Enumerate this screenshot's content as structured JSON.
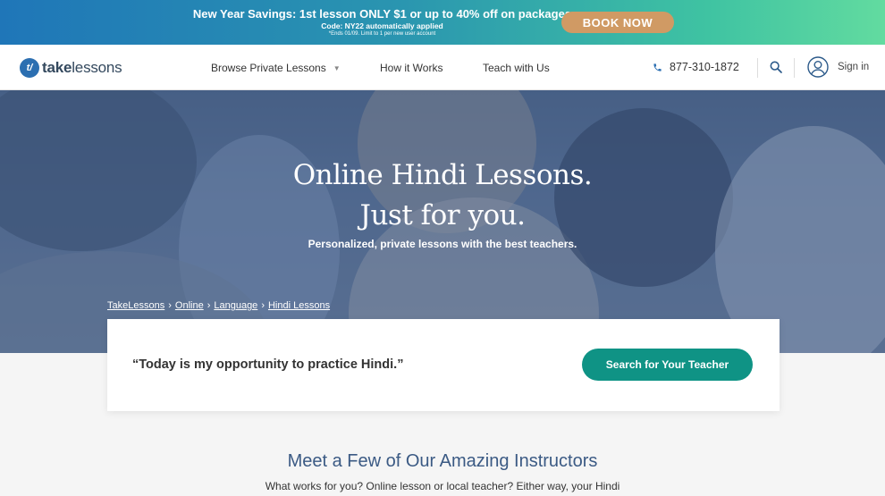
{
  "promo": {
    "headline": "New Year Savings: 1st lesson ONLY $1 or up to 40% off on packages",
    "code": "Code: NY22 automatically applied",
    "fine_print": "*Ends 01/09. Limit to 1 per new user account",
    "button": "BOOK NOW"
  },
  "nav": {
    "logo_badge": "t/",
    "logo_bold": "take",
    "logo_rest": "lessons",
    "links": [
      "Browse Private Lessons",
      "How it Works",
      "Teach with Us"
    ],
    "phone": "877-310-1872",
    "signin": "Sign in"
  },
  "hero": {
    "title_line1": "Online Hindi Lessons.",
    "title_line2": "Just for you.",
    "subtitle": "Personalized, private lessons with the best teachers.",
    "breadcrumbs": [
      "TakeLessons",
      "Online",
      "Language",
      "Hindi Lessons"
    ],
    "breadcrumb_sep": "›"
  },
  "card": {
    "quote": "“Today is my opportunity to practice Hindi.”",
    "button": "Search for Your Teacher"
  },
  "instructors": {
    "title": "Meet a Few of Our Amazing Instructors",
    "subtitle": "What works for you? Online lesson or local teacher? Either way, your Hindi"
  },
  "colors": {
    "brand_blue": "#2c6fb1",
    "cta_teal": "#0f9385",
    "book_button": "#d09a64",
    "section_title": "#3b5a84"
  }
}
